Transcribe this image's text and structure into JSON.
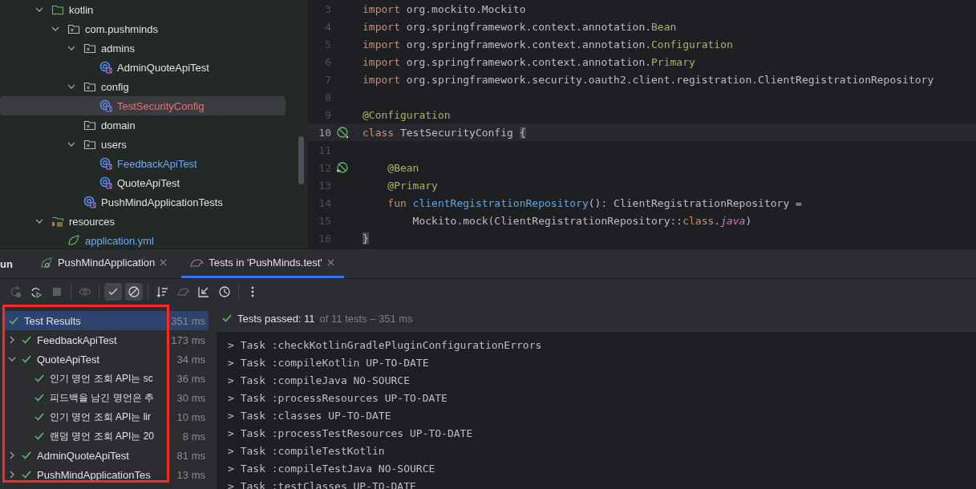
{
  "project_tree": [
    {
      "label": "kotlin",
      "kind": "source-folder",
      "expanded": true,
      "selected": false,
      "color": "#dfe1e5",
      "children": [
        {
          "label": "com.pushminds",
          "kind": "package",
          "expanded": true,
          "selected": false,
          "color": "#dfe1e5",
          "children": [
            {
              "label": "admins",
              "kind": "package",
              "expanded": true,
              "selected": false,
              "color": "#dfe1e5",
              "children": [
                {
                  "label": "AdminQuoteApiTest",
                  "kind": "kotlin-test",
                  "selected": false,
                  "color": "#dfe1e5"
                }
              ]
            },
            {
              "label": "config",
              "kind": "package",
              "expanded": true,
              "selected": false,
              "color": "#dfe1e5",
              "children": [
                {
                  "label": "TestSecurityConfig",
                  "kind": "kotlin-test",
                  "selected": true,
                  "color": "#e57373"
                }
              ]
            },
            {
              "label": "domain",
              "kind": "package",
              "selected": false,
              "color": "#dfe1e5"
            },
            {
              "label": "users",
              "kind": "package",
              "expanded": true,
              "selected": false,
              "color": "#dfe1e5",
              "children": [
                {
                  "label": "FeedbackApiTest",
                  "kind": "kotlin-test",
                  "selected": false,
                  "color": "#6fa8f5"
                },
                {
                  "label": "QuoteApiTest",
                  "kind": "kotlin-test",
                  "selected": false,
                  "color": "#dfe1e5"
                }
              ]
            },
            {
              "label": "PushMindApplicationTests",
              "kind": "kotlin-test",
              "selected": false,
              "color": "#dfe1e5"
            }
          ]
        }
      ]
    },
    {
      "label": "resources",
      "kind": "resources-folder",
      "expanded": true,
      "selected": false,
      "color": "#dfe1e5",
      "children": [
        {
          "label": "application.yml",
          "kind": "spring-file",
          "selected": false,
          "color": "#6fa8f5"
        }
      ]
    }
  ],
  "editor": {
    "lines": [
      {
        "number": "3",
        "current": false,
        "kind": "plain",
        "tokens": [
          {
            "text": "import",
            "kind": "kw"
          },
          {
            "text": " org.mockito.Mockito",
            "kind": "plain"
          }
        ]
      },
      {
        "number": "4",
        "current": false,
        "kind": "plain",
        "tokens": [
          {
            "text": "import",
            "kind": "kw"
          },
          {
            "text": " org.springframework.context.annotation.",
            "kind": "plain"
          },
          {
            "text": "Bean",
            "kind": "annotation"
          }
        ]
      },
      {
        "number": "5",
        "current": false,
        "kind": "plain",
        "tokens": [
          {
            "text": "import",
            "kind": "kw"
          },
          {
            "text": " org.springframework.context.annotation.",
            "kind": "plain"
          },
          {
            "text": "Configuration",
            "kind": "annotation"
          }
        ]
      },
      {
        "number": "6",
        "current": false,
        "kind": "plain",
        "tokens": [
          {
            "text": "import",
            "kind": "kw"
          },
          {
            "text": " org.springframework.context.annotation.",
            "kind": "plain"
          },
          {
            "text": "Primary",
            "kind": "annotation"
          }
        ]
      },
      {
        "number": "7",
        "current": false,
        "kind": "plain",
        "tokens": [
          {
            "text": "import",
            "kind": "kw"
          },
          {
            "text": " org.springframework.security.oauth2.client.registration.ClientRegistrationRepository",
            "kind": "plain"
          }
        ]
      },
      {
        "number": "8",
        "current": false,
        "kind": "plain"
      },
      {
        "number": "9",
        "current": false,
        "kind": "plain",
        "tokens": [
          {
            "text": "@Configuration",
            "kind": "annotation"
          }
        ]
      },
      {
        "number": "10",
        "current": true,
        "kind": "bean",
        "tokens": [
          {
            "text": "class",
            "kind": "kw"
          },
          {
            "text": " TestSecurityConfig ",
            "kind": "plain"
          },
          {
            "text": "{",
            "kind": "brace"
          }
        ]
      },
      {
        "number": "11",
        "current": false,
        "kind": "plain"
      },
      {
        "number": "12",
        "current": false,
        "kind": "bean-usage",
        "tokens": [
          {
            "text": "    @Bean",
            "kind": "annotation"
          }
        ]
      },
      {
        "number": "13",
        "current": false,
        "kind": "plain",
        "tokens": [
          {
            "text": "    @Primary",
            "kind": "annotation"
          }
        ]
      },
      {
        "number": "14",
        "current": false,
        "kind": "plain",
        "tokens": [
          {
            "text": "    fun",
            "kind": "kw"
          },
          {
            "text": " clientRegistrationRepository",
            "kind": "fn"
          },
          {
            "text": "(): ClientRegistrationRepository =",
            "kind": "plain"
          }
        ]
      },
      {
        "number": "15",
        "current": false,
        "kind": "plain",
        "tokens": [
          {
            "text": "        Mockito.mock(ClientRegistrationRepository::",
            "kind": "plain"
          },
          {
            "text": "class",
            "kind": "kw"
          },
          {
            "text": ".",
            "kind": "plain"
          },
          {
            "text": "java",
            "kind": "prop"
          },
          {
            "text": ")",
            "kind": "plain"
          }
        ]
      },
      {
        "number": "16",
        "current": false,
        "kind": "plain",
        "tokens": [
          {
            "text": "}",
            "kind": "brace"
          }
        ]
      }
    ]
  },
  "run_panel": {
    "title": "un",
    "tabs": [
      {
        "label": "PushMindApplication",
        "kind": "spring",
        "selected": false
      },
      {
        "label": "Tests in 'PushMinds.test'",
        "kind": "tests",
        "selected": true
      }
    ],
    "toolbar": [
      {
        "kind": "rerun",
        "on": false,
        "disabled": true
      },
      {
        "kind": "rerun-failed",
        "on": false,
        "disabled": false
      },
      {
        "kind": "stop",
        "on": false,
        "disabled": true
      },
      {
        "kind": "eye",
        "on": false,
        "disabled": true
      },
      {
        "kind": "passed",
        "on": true,
        "disabled": false
      },
      {
        "kind": "ignored",
        "on": true,
        "disabled": false
      },
      {
        "kind": "sort",
        "on": false,
        "disabled": false
      },
      {
        "kind": "import",
        "on": false,
        "disabled": true
      },
      {
        "kind": "collapse",
        "on": false,
        "disabled": false
      },
      {
        "kind": "history",
        "on": false,
        "disabled": false
      },
      {
        "kind": "more",
        "on": false,
        "disabled": false
      }
    ],
    "test_tree": [
      {
        "label": "Test Results",
        "duration": "351 ms",
        "kind": "passed",
        "selected": true,
        "children": [
          {
            "label": "FeedbackApiTest",
            "duration": "173 ms",
            "kind": "passed",
            "selected": false,
            "expanded": false
          },
          {
            "label": "QuoteApiTest",
            "duration": "34 ms",
            "kind": "passed",
            "selected": false,
            "expanded": true,
            "children": [
              {
                "label": "인기 명언 조회 API는 sc",
                "duration": "36 ms",
                "kind": "passed",
                "selected": false
              },
              {
                "label": "피드백을 남긴 명언은 추",
                "duration": "30 ms",
                "kind": "passed",
                "selected": false
              },
              {
                "label": "인기 명언 조회 API는 lir",
                "duration": "10 ms",
                "kind": "passed",
                "selected": false
              },
              {
                "label": "랜덤 명언 조회 API는 20",
                "duration": "8 ms",
                "kind": "passed",
                "selected": false
              }
            ]
          },
          {
            "label": "AdminQuoteApiTest",
            "duration": "81 ms",
            "kind": "passed",
            "selected": false,
            "expanded": false
          },
          {
            "label": "PushMindApplicationTes",
            "duration": "13 ms",
            "kind": "passed",
            "selected": false,
            "expanded": false
          }
        ]
      }
    ],
    "summary": {
      "kind": "passed",
      "headline": "Tests passed: 11",
      "detail": "of 11 tests – 351 ms"
    },
    "console_lines": [
      "> Task :checkKotlinGradlePluginConfigurationErrors",
      "> Task :compileKotlin UP-TO-DATE",
      "> Task :compileJava NO-SOURCE",
      "> Task :processResources UP-TO-DATE",
      "> Task :classes UP-TO-DATE",
      "> Task :processTestResources UP-TO-DATE",
      "> Task :compileTestKotlin",
      "> Task :compileTestJava NO-SOURCE",
      "> Task :testClasses UP-TO-DATE"
    ]
  }
}
